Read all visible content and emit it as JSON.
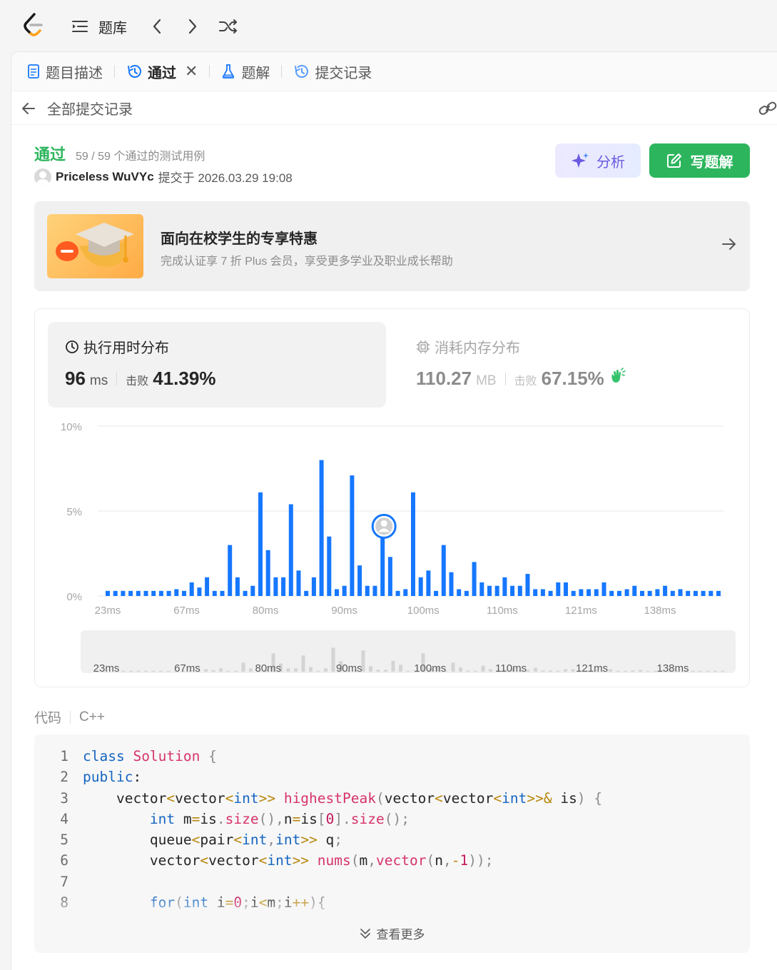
{
  "nav": {
    "problems_label": "题库"
  },
  "tabs": [
    {
      "label": "题目描述",
      "icon": "doc-icon"
    },
    {
      "label": "通过",
      "icon": "history-icon",
      "active": true
    },
    {
      "label": "题解",
      "icon": "flask-icon"
    },
    {
      "label": "提交记录",
      "icon": "history-icon"
    }
  ],
  "subbar": {
    "back_label": "全部提交记录"
  },
  "submission": {
    "status": "通过",
    "passed_text": "59 / 59 个通过的测试用例",
    "author": "Priceless WuVYc",
    "submitted_text": "提交于 2026.03.29 19:08",
    "analyze_label": "分析",
    "write_solution_label": "写题解"
  },
  "promo": {
    "title": "面向在校学生的专享特惠",
    "desc": "完成认证享 7 折 Plus 会员，享受更多学业及职业成长帮助"
  },
  "runtime": {
    "label": "执行用时分布",
    "value": "96",
    "unit": "ms",
    "beat_label": "击败",
    "beat_pct": "41.39%"
  },
  "memory": {
    "label": "消耗内存分布",
    "value": "110.27",
    "unit": "MB",
    "beat_label": "击败",
    "beat_pct": "67.15%"
  },
  "colors": {
    "accent_green": "#2db55d",
    "bar_blue": "#1677ff",
    "analyze_purple": "#6a5ae0"
  },
  "chart_data": {
    "type": "bar",
    "title": "",
    "xlabel": "",
    "ylabel": "",
    "ylim": [
      0,
      10
    ],
    "yticks": [
      "10%",
      "5%",
      "0%"
    ],
    "xticks": [
      "23ms",
      "67ms",
      "80ms",
      "90ms",
      "100ms",
      "110ms",
      "121ms",
      "138ms"
    ],
    "grid": true,
    "values": [
      0.3,
      0.3,
      0.3,
      0.3,
      0.3,
      0.3,
      0.3,
      0.3,
      0.3,
      0.4,
      0.3,
      0.8,
      0.5,
      1.1,
      0.3,
      0.3,
      3.0,
      1.1,
      0.3,
      0.6,
      6.1,
      2.7,
      1.1,
      1.1,
      5.4,
      1.5,
      0.3,
      1.1,
      8.0,
      3.5,
      0.4,
      0.6,
      7.1,
      1.8,
      0.6,
      0.6,
      3.6,
      2.3,
      0.3,
      0.4,
      6.1,
      1.1,
      1.5,
      0.3,
      3.0,
      1.4,
      0.4,
      0.3,
      2.0,
      0.8,
      0.6,
      0.6,
      1.1,
      0.6,
      0.6,
      1.3,
      0.4,
      0.4,
      0.3,
      0.8,
      0.8,
      0.3,
      0.4,
      0.4,
      0.4,
      0.8,
      0.3,
      0.3,
      0.4,
      0.6,
      0.3,
      0.3,
      0.4,
      0.6,
      0.3,
      0.4,
      0.3,
      0.3,
      0.3,
      0.3,
      0.3
    ],
    "highlight_index": 36,
    "minimap_xticks": [
      "23ms",
      "67ms",
      "80ms",
      "90ms",
      "100ms",
      "110ms",
      "121ms",
      "138ms"
    ]
  },
  "code": {
    "label": "代码",
    "language": "C++",
    "more_label": "查看更多",
    "lines": [
      {
        "n": "1",
        "tokens": [
          [
            "kw",
            "class "
          ],
          [
            "cls",
            "Solution"
          ],
          [
            "pun",
            " {"
          ]
        ]
      },
      {
        "n": "2",
        "tokens": [
          [
            "kw",
            "public"
          ],
          [
            "plain",
            ":"
          ]
        ]
      },
      {
        "n": "3",
        "tokens": [
          [
            "plain",
            "    vector"
          ],
          [
            "op",
            "<"
          ],
          [
            "plain",
            "vector"
          ],
          [
            "op",
            "<"
          ],
          [
            "kw",
            "int"
          ],
          [
            "op",
            ">>"
          ],
          [
            "plain",
            " "
          ],
          [
            "fn",
            "highestPeak"
          ],
          [
            "pun",
            "("
          ],
          [
            "plain",
            "vector"
          ],
          [
            "op",
            "<"
          ],
          [
            "plain",
            "vector"
          ],
          [
            "op",
            "<"
          ],
          [
            "kw",
            "int"
          ],
          [
            "op",
            ">>&"
          ],
          [
            "plain",
            " is"
          ],
          [
            "pun",
            ")"
          ],
          [
            "pun",
            " {"
          ]
        ]
      },
      {
        "n": "4",
        "tokens": [
          [
            "plain",
            "        "
          ],
          [
            "kw",
            "int"
          ],
          [
            "plain",
            " m"
          ],
          [
            "op",
            "="
          ],
          [
            "plain",
            "is"
          ],
          [
            "pun",
            "."
          ],
          [
            "fn",
            "size"
          ],
          [
            "pun",
            "(),"
          ],
          [
            "plain",
            "n"
          ],
          [
            "op",
            "="
          ],
          [
            "plain",
            "is"
          ],
          [
            "pun",
            "["
          ],
          [
            "num",
            "0"
          ],
          [
            "pun",
            "]."
          ],
          [
            "fn",
            "size"
          ],
          [
            "pun",
            "();"
          ]
        ]
      },
      {
        "n": "5",
        "tokens": [
          [
            "plain",
            "        queue"
          ],
          [
            "op",
            "<"
          ],
          [
            "plain",
            "pair"
          ],
          [
            "op",
            "<"
          ],
          [
            "kw",
            "int"
          ],
          [
            "pun",
            ","
          ],
          [
            "kw",
            "int"
          ],
          [
            "op",
            ">>"
          ],
          [
            "plain",
            " q"
          ],
          [
            "pun",
            ";"
          ]
        ]
      },
      {
        "n": "6",
        "tokens": [
          [
            "plain",
            "        vector"
          ],
          [
            "op",
            "<"
          ],
          [
            "plain",
            "vector"
          ],
          [
            "op",
            "<"
          ],
          [
            "kw",
            "int"
          ],
          [
            "op",
            ">>"
          ],
          [
            "plain",
            " "
          ],
          [
            "fn",
            "nums"
          ],
          [
            "pun",
            "("
          ],
          [
            "plain",
            "m"
          ],
          [
            "pun",
            ","
          ],
          [
            "fn",
            "vector"
          ],
          [
            "pun",
            "("
          ],
          [
            "plain",
            "n"
          ],
          [
            "pun",
            ","
          ],
          [
            "op",
            "-"
          ],
          [
            "num",
            "1"
          ],
          [
            "pun",
            "));"
          ]
        ]
      },
      {
        "n": "7",
        "tokens": []
      },
      {
        "n": "8",
        "tokens": [
          [
            "plain",
            "        "
          ],
          [
            "kw",
            "for"
          ],
          [
            "pun",
            "("
          ],
          [
            "kw",
            "int"
          ],
          [
            "plain",
            " i"
          ],
          [
            "op",
            "="
          ],
          [
            "num",
            "0"
          ],
          [
            "pun",
            ";"
          ],
          [
            "plain",
            "i"
          ],
          [
            "op",
            "<"
          ],
          [
            "plain",
            "m"
          ],
          [
            "pun",
            ";"
          ],
          [
            "plain",
            "i"
          ],
          [
            "op",
            "++"
          ],
          [
            "pun",
            "){"
          ]
        ]
      }
    ]
  }
}
